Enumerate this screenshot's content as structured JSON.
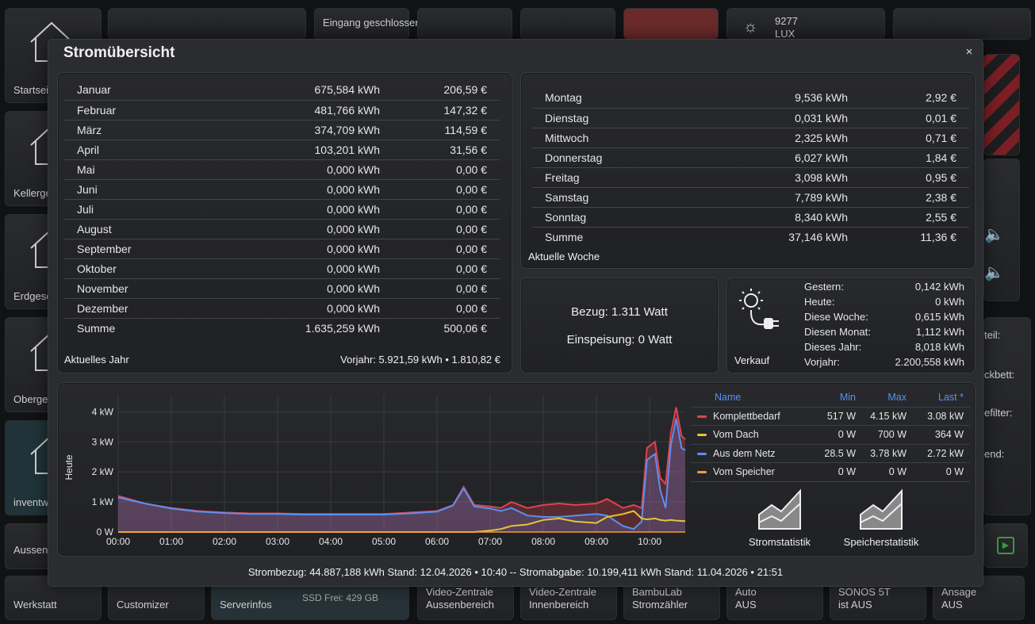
{
  "background": {
    "tiles_top": [
      "Eingang geschlossen",
      "9277 LUX"
    ],
    "left_labels": [
      "Startseite",
      "Kellergeschoss",
      "Erdgeschoss",
      "Obergeschoss",
      "inventwo",
      "Aussenbereich"
    ],
    "bottom": [
      {
        "l1": "Werkstatt",
        "l2": ""
      },
      {
        "l1": "Customizer",
        "l2": ""
      },
      {
        "l1": "Serverinfos",
        "l2": "SSD Frei: 429 GB"
      },
      {
        "l1": "Video-Zentrale",
        "l2": "Aussenbereich"
      },
      {
        "l1": "Video-Zentrale",
        "l2": "Innenbereich"
      },
      {
        "l1": "BambuLab",
        "l2": "Stromzähler"
      },
      {
        "l1": "Auto",
        "l2": "AUS"
      },
      {
        "l1": "SONOS 5T",
        "l2": "ist AUS"
      },
      {
        "l1": "Ansage",
        "l2": "AUS"
      }
    ],
    "right_labels": [
      "teil:",
      "ckbett:",
      "efilter:",
      "end:"
    ]
  },
  "modal": {
    "title": "Stromübersicht",
    "close": "×",
    "year": {
      "rows": [
        {
          "m": "Januar",
          "kwh": "675,584 kWh",
          "eur": "206,59 €"
        },
        {
          "m": "Februar",
          "kwh": "481,766 kWh",
          "eur": "147,32 €"
        },
        {
          "m": "März",
          "kwh": "374,709 kWh",
          "eur": "114,59 €"
        },
        {
          "m": "April",
          "kwh": "103,201 kWh",
          "eur": "31,56 €"
        },
        {
          "m": "Mai",
          "kwh": "0,000 kWh",
          "eur": "0,00 €"
        },
        {
          "m": "Juni",
          "kwh": "0,000 kWh",
          "eur": "0,00 €"
        },
        {
          "m": "Juli",
          "kwh": "0,000 kWh",
          "eur": "0,00 €"
        },
        {
          "m": "August",
          "kwh": "0,000 kWh",
          "eur": "0,00 €"
        },
        {
          "m": "September",
          "kwh": "0,000 kWh",
          "eur": "0,00 €"
        },
        {
          "m": "Oktober",
          "kwh": "0,000 kWh",
          "eur": "0,00 €"
        },
        {
          "m": "November",
          "kwh": "0,000 kWh",
          "eur": "0,00 €"
        },
        {
          "m": "Dezember",
          "kwh": "0,000 kWh",
          "eur": "0,00 €"
        },
        {
          "m": "Summe",
          "kwh": "1.635,259 kWh",
          "eur": "500,06 €"
        }
      ],
      "footer_left": "Aktuelles Jahr",
      "footer_right": "Vorjahr: 5.921,59 kWh • 1.810,82 €"
    },
    "week": {
      "rows": [
        {
          "d": "Montag",
          "kwh": "9,536 kWh",
          "eur": "2,92 €"
        },
        {
          "d": "Dienstag",
          "kwh": "0,031 kWh",
          "eur": "0,01 €"
        },
        {
          "d": "Mittwoch",
          "kwh": "2,325 kWh",
          "eur": "0,71 €"
        },
        {
          "d": "Donnerstag",
          "kwh": "6,027 kWh",
          "eur": "1,84 €"
        },
        {
          "d": "Freitag",
          "kwh": "3,098 kWh",
          "eur": "0,95 €"
        },
        {
          "d": "Samstag",
          "kwh": "7,789 kWh",
          "eur": "2,38 €"
        },
        {
          "d": "Sonntag",
          "kwh": "8,340 kWh",
          "eur": "2,55 €"
        },
        {
          "d": "Summe",
          "kwh": "37,146 kWh",
          "eur": "11,36 €"
        }
      ],
      "footer": "Aktuelle Woche"
    },
    "live": {
      "bezug": "Bezug: 1.311 Watt",
      "einspeisung": "Einspeisung: 0 Watt"
    },
    "sale": {
      "label": "Verkauf",
      "rows": [
        {
          "k": "Gestern:",
          "v": "0,142 kWh"
        },
        {
          "k": "Heute:",
          "v": "0 kWh"
        },
        {
          "k": "Diese Woche:",
          "v": "0,615 kWh"
        },
        {
          "k": "Diesen Monat:",
          "v": "1,112 kWh"
        },
        {
          "k": "Dieses Jahr:",
          "v": "8,018 kWh"
        },
        {
          "k": "Vorjahr:",
          "v": "2.200,558 kWh"
        }
      ]
    },
    "legend": {
      "headers": {
        "name": "Name",
        "min": "Min",
        "max": "Max",
        "last": "Last *"
      },
      "rows": [
        {
          "name": "Komplettbedarf",
          "color": "#e0434f",
          "min": "517 W",
          "max": "4.15 kW",
          "last": "3.08 kW"
        },
        {
          "name": "Vom Dach",
          "color": "#e8c23a",
          "min": "0 W",
          "max": "700 W",
          "last": "364 W"
        },
        {
          "name": "Aus dem Netz",
          "color": "#5b8ff0",
          "min": "28.5 W",
          "max": "3.78 kW",
          "last": "2.72 kW"
        },
        {
          "name": "Vom Speicher",
          "color": "#f29a3d",
          "min": "0 W",
          "max": "0 W",
          "last": "0 W"
        }
      ]
    },
    "buttons": {
      "strom": "Stromstatistik",
      "speicher": "Speicherstatistik"
    },
    "footer": "Strombezug: 44.887,188 kWh Stand: 12.04.2026 • 10:40 -- Stromabgabe: 10.199,411 kWh Stand: 11.04.2026 • 21:51"
  },
  "chart_data": {
    "type": "area",
    "ylabel": "Heute",
    "x": [
      0,
      0.5,
      1,
      1.5,
      2,
      2.5,
      3,
      3.5,
      4,
      4.5,
      5,
      5.5,
      6,
      6.3,
      6.5,
      6.7,
      7,
      7.2,
      7.4,
      7.7,
      8,
      8.3,
      8.6,
      9,
      9.2,
      9.5,
      9.7,
      9.85,
      9.95,
      10.1,
      10.2,
      10.3,
      10.4,
      10.5,
      10.6,
      10.67
    ],
    "xticks": [
      "00:00",
      "01:00",
      "02:00",
      "03:00",
      "04:00",
      "05:00",
      "06:00",
      "07:00",
      "08:00",
      "09:00",
      "10:00"
    ],
    "yticks": [
      "0 W",
      "1 kW",
      "2 kW",
      "3 kW",
      "4 kW"
    ],
    "ylim": [
      0,
      4.3
    ],
    "series": [
      {
        "name": "Komplettbedarf",
        "color": "#e0434f",
        "values": [
          1.2,
          0.95,
          0.8,
          0.7,
          0.65,
          0.62,
          0.62,
          0.6,
          0.6,
          0.6,
          0.6,
          0.65,
          0.7,
          0.9,
          1.5,
          0.9,
          0.85,
          0.8,
          1.0,
          0.8,
          0.9,
          0.95,
          0.9,
          0.95,
          1.1,
          0.8,
          0.9,
          0.8,
          2.8,
          3.0,
          1.8,
          1.6,
          3.3,
          4.15,
          3.2,
          3.08
        ]
      },
      {
        "name": "Vom Dach",
        "color": "#e8c23a",
        "values": [
          0,
          0,
          0,
          0,
          0,
          0,
          0,
          0,
          0,
          0,
          0,
          0,
          0,
          0,
          0,
          0,
          0.05,
          0.1,
          0.2,
          0.25,
          0.4,
          0.45,
          0.35,
          0.3,
          0.5,
          0.6,
          0.7,
          0.45,
          0.42,
          0.45,
          0.4,
          0.38,
          0.4,
          0.38,
          0.37,
          0.364
        ]
      },
      {
        "name": "Aus dem Netz",
        "color": "#5b8ff0",
        "values": [
          1.15,
          0.95,
          0.78,
          0.68,
          0.63,
          0.6,
          0.6,
          0.58,
          0.58,
          0.58,
          0.58,
          0.62,
          0.68,
          0.88,
          1.45,
          0.85,
          0.78,
          0.7,
          0.8,
          0.55,
          0.5,
          0.5,
          0.55,
          0.6,
          0.55,
          0.2,
          0.1,
          0.35,
          2.4,
          2.6,
          1.4,
          0.8,
          2.9,
          3.78,
          2.8,
          2.72
        ]
      },
      {
        "name": "Vom Speicher",
        "color": "#f29a3d",
        "values": [
          0,
          0,
          0,
          0,
          0,
          0,
          0,
          0,
          0,
          0,
          0,
          0,
          0,
          0,
          0,
          0,
          0,
          0,
          0,
          0,
          0,
          0,
          0,
          0,
          0,
          0,
          0,
          0,
          0,
          0,
          0,
          0,
          0,
          0,
          0,
          0
        ]
      }
    ]
  }
}
